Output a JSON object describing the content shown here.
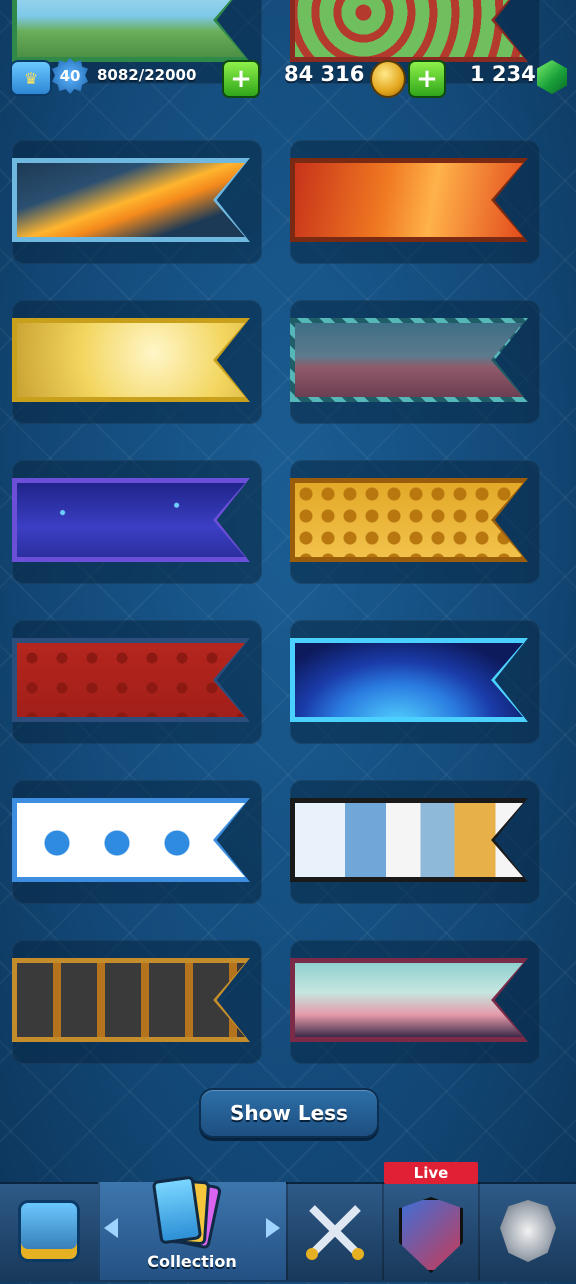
{
  "header": {
    "level": "40",
    "xp": "8082/22000",
    "gold": "84 316",
    "gems": "1 234",
    "plus_symbol": "+"
  },
  "banners": [
    {
      "name": "meadow-banner",
      "colors": [
        "#7ec8e8",
        "#5a9b55"
      ]
    },
    {
      "name": "goblin-banner",
      "colors": [
        "#6fbf5e",
        "#b43a2e"
      ]
    },
    {
      "name": "golden-flame-banner",
      "colors": [
        "#1f3f5e",
        "#ffb52e"
      ]
    },
    {
      "name": "fire-banner",
      "colors": [
        "#e24b1c",
        "#ff9a30"
      ]
    },
    {
      "name": "golden-temple-banner",
      "colors": [
        "#f3d660",
        "#fff3b0"
      ]
    },
    {
      "name": "candle-wood-banner",
      "colors": [
        "#3e6f86",
        "#8f5a6a"
      ]
    },
    {
      "name": "constellation-banner",
      "colors": [
        "#2b2f9e",
        "#4d4fd6"
      ]
    },
    {
      "name": "gold-pattern-banner",
      "colors": [
        "#d99a1c",
        "#f2c24b"
      ]
    },
    {
      "name": "red-star-banner",
      "colors": [
        "#a21f1a",
        "#d1342a"
      ]
    },
    {
      "name": "planet-banner",
      "colors": [
        "#1f4fbf",
        "#53d4ff"
      ]
    },
    {
      "name": "blue-bat-banner",
      "colors": [
        "#ffffff",
        "#2f8be0"
      ]
    },
    {
      "name": "comic-banner",
      "colors": [
        "#ffffff",
        "#e8b049"
      ]
    },
    {
      "name": "rock-speakers-banner",
      "colors": [
        "#b5731e",
        "#3a3a3a"
      ]
    },
    {
      "name": "pastel-sky-banner",
      "colors": [
        "#7fc9c6",
        "#e39aa9"
      ]
    }
  ],
  "show_less_label": "Show Less",
  "nav": {
    "collection_label": "Collection",
    "live_label": "Live"
  }
}
